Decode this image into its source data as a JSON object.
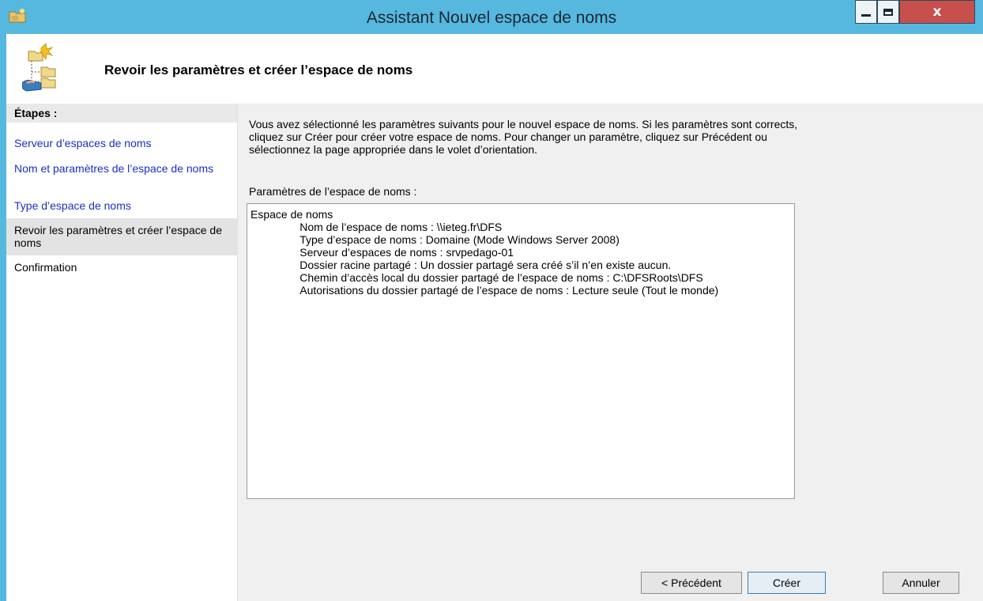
{
  "window": {
    "title": "Assistant Nouvel espace de noms",
    "close_glyph": "x"
  },
  "header": {
    "heading": "Revoir les paramètres et créer l’espace de noms",
    "icon": "namespace-wizard-icon"
  },
  "nav": {
    "title": "Étapes :",
    "steps": [
      {
        "label": "Serveur d’espaces de noms",
        "state": "link"
      },
      {
        "label": "Nom et paramètres de l’espace de noms",
        "state": "link"
      },
      {
        "label": "Type d’espace de noms",
        "state": "link"
      },
      {
        "label": "Revoir les paramètres et créer l’espace de noms",
        "state": "current"
      },
      {
        "label": "Confirmation",
        "state": "future"
      }
    ]
  },
  "main": {
    "intro": "Vous avez sélectionné les paramètres suivants pour le nouvel espace de noms. Si les paramètres sont corrects, cliquez sur Créer pour créer votre espace de noms. Pour changer un paramètre, cliquez sur Précédent ou sélectionnez la page appropriée dans le volet d’orientation.",
    "params_label": "Paramètres de l’espace de noms :",
    "params_text": "Espace de noms\n\t\tNom de l’espace de noms : \\\\ieteg.fr\\DFS\n\t\tType d’espace de noms : Domaine (Mode Windows Server 2008)\n\t\tServeur d’espaces de noms : srvpedago-01\n\t\tDossier racine partagé : Un dossier partagé sera créé s’il n’en existe aucun.\n\t\tChemin d’accès local du dossier partagé de l’espace de noms : C:\\DFSRoots\\DFS\n\t\tAutorisations du dossier partagé de l’espace de noms : Lecture seule (Tout le monde)"
  },
  "buttons": {
    "previous": "< Précédent",
    "create": "Créer",
    "cancel": "Annuler"
  },
  "colors": {
    "titlebar": "#56b8df",
    "close_button": "#c7504c",
    "link": "#1c2fc4",
    "content_bg": "#f0f0f0"
  }
}
